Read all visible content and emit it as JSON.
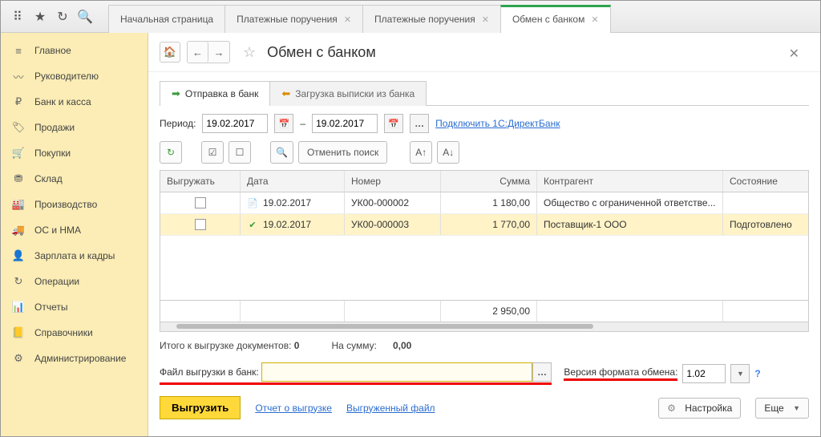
{
  "topbar": {
    "tabs": [
      {
        "label": "Начальная страница",
        "closable": false,
        "active": false
      },
      {
        "label": "Платежные поручения",
        "closable": true,
        "active": false
      },
      {
        "label": "Платежные поручения",
        "closable": true,
        "active": false
      },
      {
        "label": "Обмен с банком",
        "closable": true,
        "active": true
      }
    ]
  },
  "sidebar": {
    "items": [
      {
        "label": "Главное",
        "icon": "≡"
      },
      {
        "label": "Руководителю",
        "icon": "〰"
      },
      {
        "label": "Банк и касса",
        "icon": "₽"
      },
      {
        "label": "Продажи",
        "icon": "🏷"
      },
      {
        "label": "Покупки",
        "icon": "🛒"
      },
      {
        "label": "Склад",
        "icon": "⛃"
      },
      {
        "label": "Производство",
        "icon": "🏭"
      },
      {
        "label": "ОС и НМА",
        "icon": "🚚"
      },
      {
        "label": "Зарплата и кадры",
        "icon": "👤"
      },
      {
        "label": "Операции",
        "icon": "↻"
      },
      {
        "label": "Отчеты",
        "icon": "📊"
      },
      {
        "label": "Справочники",
        "icon": "📒"
      },
      {
        "label": "Администрирование",
        "icon": "⚙"
      }
    ]
  },
  "header": {
    "title": "Обмен с банком"
  },
  "inner_tabs": {
    "send": "Отправка в банк",
    "load": "Загрузка выписки из банка"
  },
  "period": {
    "label": "Период:",
    "from": "19.02.2017",
    "to": "19.02.2017",
    "dash": "–",
    "connect_link": "Подключить 1С:ДиректБанк"
  },
  "toolbar": {
    "cancel_search": "Отменить поиск"
  },
  "table": {
    "headers": {
      "export": "Выгружать",
      "date": "Дата",
      "number": "Номер",
      "sum": "Сумма",
      "agent": "Контрагент",
      "status": "Состояние"
    },
    "rows": [
      {
        "date": "19.02.2017",
        "number": "УК00-000002",
        "sum": "1 180,00",
        "agent": "Общество с ограниченной ответстве...",
        "status": ""
      },
      {
        "date": "19.02.2017",
        "number": "УК00-000003",
        "sum": "1 770,00",
        "agent": "Поставщик-1 ООО",
        "status": "Подготовлено"
      }
    ],
    "total_sum": "2 950,00"
  },
  "summary": {
    "docs_label": "Итого к выгрузке документов:",
    "docs_value": "0",
    "sum_label": "На сумму:",
    "sum_value": "0,00"
  },
  "file": {
    "label": "Файл выгрузки в банк:",
    "value": "",
    "version_label": "Версия формата обмена:",
    "version_value": "1.02"
  },
  "actions": {
    "export": "Выгрузить",
    "report_link": "Отчет о выгрузке",
    "file_link": "Выгруженный файл",
    "settings": "Настройка",
    "more": "Еще"
  }
}
